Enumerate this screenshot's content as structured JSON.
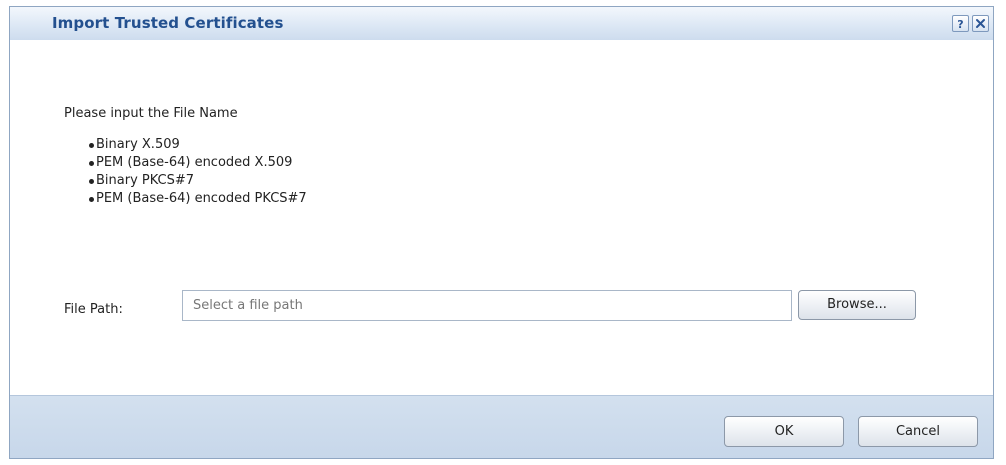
{
  "dialog": {
    "title": "Import Trusted Certificates",
    "help_icon": "help-icon",
    "close_icon": "close-icon"
  },
  "content": {
    "intro": "Please input the File Name",
    "formats": [
      "Binary X.509",
      "PEM (Base-64) encoded X.509",
      "Binary PKCS#7",
      "PEM (Base-64) encoded PKCS#7"
    ],
    "file_path_label": "File Path:",
    "file_path_placeholder": "Select a file path",
    "file_path_value": "",
    "browse_label": "Browse..."
  },
  "footer": {
    "ok_label": "OK",
    "cancel_label": "Cancel"
  },
  "colors": {
    "title_text": "#23508f",
    "titlebar_bg": "#dde8f5",
    "footer_bg": "#cddcee",
    "border": "#8fa6c2"
  }
}
